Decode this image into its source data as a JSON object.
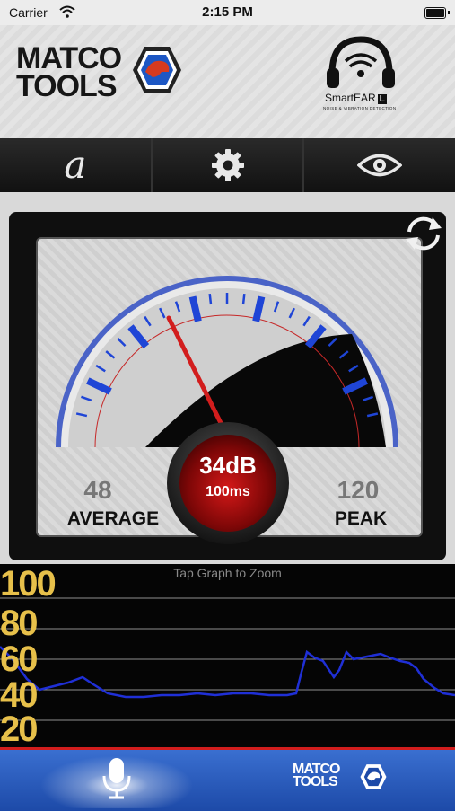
{
  "status_bar": {
    "carrier": "Carrier",
    "time": "2:15 PM"
  },
  "header": {
    "brand_line1": "MATCO",
    "brand_line2": "TOOLS",
    "product_name": "SmartEAR",
    "product_suffix": "L",
    "product_tagline": "NOISE & VIBRATION DETECTION"
  },
  "toolbar": {
    "items": [
      {
        "icon": "italic-a-icon",
        "label": "a"
      },
      {
        "icon": "gear-icon"
      },
      {
        "icon": "eye-icon"
      }
    ]
  },
  "gauge": {
    "reading": "34dB",
    "interval": "100ms",
    "needle_db": 34,
    "scale_max": 120,
    "average_value": "48",
    "average_label": "AVERAGE",
    "peak_value": "120",
    "peak_label": "PEAK",
    "refresh_icon": "refresh-icon"
  },
  "graph": {
    "hint": "Tap Graph to Zoom",
    "y_ticks": [
      "100",
      "80",
      "60",
      "40",
      "20"
    ],
    "colors": {
      "tick": "#e7c04a",
      "low": "#1f2fd6",
      "high": "#2fd24a",
      "gridline": "#9a9a9a"
    }
  },
  "bottom_bar": {
    "mic_icon": "microphone-icon",
    "brand_line1": "MATCO",
    "brand_line2": "TOOLS",
    "accent": "#d21d1d"
  }
}
